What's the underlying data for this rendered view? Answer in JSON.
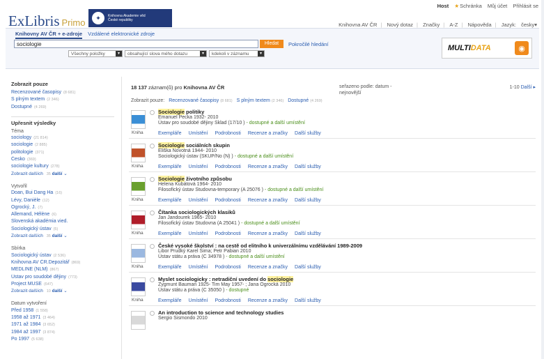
{
  "topbar": {
    "host": "Host",
    "clipboard": "Schránka",
    "account": "Můj účet",
    "login": "Přihlásit se"
  },
  "logo": {
    "exlibris": "ExLibris",
    "primo": "Primo"
  },
  "institution": {
    "name_line1": "Knihovna Akademie věd",
    "name_line2": "České republiky"
  },
  "mainnav": [
    "Knihovna AV ČR",
    "Nový dotaz",
    "Značky",
    "A-Z",
    "Nápověda",
    "Jazyk:",
    "česky"
  ],
  "tabs": {
    "active": "Knihovny AV ČR + e-zdroje",
    "second": "Vzdálené elektronické zdroje"
  },
  "search": {
    "value": "sociologie",
    "button": "Hledat",
    "advanced": "Pokročilé hledání"
  },
  "selects": [
    "Všechny položky",
    "obsahující slova mého dotazu",
    "kdekoli v záznamu"
  ],
  "multidata": {
    "logo_a": "MULTI",
    "logo_b": "DATA"
  },
  "sidebar": {
    "show_only_title": "Zobrazit pouze",
    "show_only": [
      {
        "label": "Recenzované časopisy",
        "count": "(8 681)"
      },
      {
        "label": "S plným textem",
        "count": "(2 346)"
      },
      {
        "label": "Dostupné",
        "count": "(4 269)"
      }
    ],
    "refine_title": "Upřesnit výsledky",
    "topic_title": "Téma",
    "topics": [
      {
        "label": "sociology",
        "count": "(21 814)"
      },
      {
        "label": "sociologie",
        "count": "(2 885)"
      },
      {
        "label": "politologie",
        "count": "(371)"
      },
      {
        "label": "Česko",
        "count": "(369)"
      },
      {
        "label": "sociologie kultury",
        "count": "(278)"
      }
    ],
    "topics_more": "Zobrazit dalších",
    "topics_more_count": "35",
    "more_label": "další",
    "creator_title": "Vytvořil",
    "creators": [
      {
        "label": "Doan, Bui Dang Ha",
        "count": "(16)"
      },
      {
        "label": "Lévy, Danièle",
        "count": "(12)"
      },
      {
        "label": "Ogrocký, J.",
        "count": "(7)"
      },
      {
        "label": "Allemand, Hélène",
        "count": "(6)"
      },
      {
        "label": "Slovenská akadémia vied.",
        "count": ""
      },
      {
        "label": "Sociologický ústav",
        "count": "(5)"
      }
    ],
    "creators_more": "Zobrazit dalších",
    "creators_more_count": "35",
    "collection_title": "Sbírka",
    "collections": [
      {
        "label": "Sociologický ústav",
        "count": "(2 536)"
      },
      {
        "label": "Knihovna AV ČR.Depozitář",
        "count": "(869)"
      },
      {
        "label": "MEDLINE (NLM)",
        "count": "(867)"
      },
      {
        "label": "Ústav pro soudobé dějiny",
        "count": "(773)"
      },
      {
        "label": "Project MUSE",
        "count": "(647)"
      }
    ],
    "collections_more": "Zobrazit dalších",
    "collections_more_count": "10",
    "date_title": "Datum vytvoření",
    "dates": [
      {
        "label": "Před 1958",
        "count": "(1 558)"
      },
      {
        "label": "1958 až 1971",
        "count": "(3 464)"
      },
      {
        "label": "1971 až 1984",
        "count": "(3 652)"
      },
      {
        "label": "1984 až 1997",
        "count": "(3 874)"
      },
      {
        "label": "Po 1997",
        "count": "(5 638)"
      }
    ]
  },
  "results_header": {
    "count": "18 137",
    "label": "záznam(ů) pro",
    "scope": "Knihovna AV ČR"
  },
  "sort": {
    "label": "seřazeno podle:",
    "value": "datum - nejnovější"
  },
  "pager": {
    "range": "1-10",
    "next": "Další"
  },
  "refine_bar": {
    "label": "Zobrazit pouze:",
    "items": [
      {
        "label": "Recenzované časopisy",
        "count": "(8 681)"
      },
      {
        "label": "S plným textem",
        "count": "(2 346)"
      },
      {
        "label": "Dostupné",
        "count": "(4 269)"
      }
    ]
  },
  "actions": [
    "Exempláře",
    "Umístění",
    "Podrobnosti",
    "Recenze a značky",
    "Další služby"
  ],
  "records": [
    {
      "title_hl": "Sociologie",
      "title_rest": " politiky",
      "author": "Emanuel Pecka 1932- 2010",
      "location": "Ústav pro soudobé dějiny Sklad (17/10 )",
      "availability": " - dostupné a další umístění",
      "format": "Kniha",
      "color": "#3b8fd6"
    },
    {
      "title_hl": "Sociologie",
      "title_rest": " sociálních skupin",
      "author": "Eliška Novotná 1944- 2010",
      "location": "Sociologický ústav   (SKUP/No (N) )",
      "availability": " - dostupné a další umístění",
      "format": "Kniha",
      "color": "#c0522a"
    },
    {
      "title_hl": "Sociologie",
      "title_rest": " životního způsobu",
      "author": "Helena Kubátová 1964- 2010",
      "location": "Filosofický ústav Studovna-temporary (A 25076 )",
      "availability": " - dostupné a další umístění",
      "format": "Kniha",
      "color": "#6aa02e"
    },
    {
      "title_hl": "",
      "title_rest": "Čítanka sociologických klasiků",
      "author": "Jan Jandourek 1965- 2010",
      "location": "Filosofický ústav Studovna (A 25041 )",
      "availability": " - dostupné a další umístění",
      "format": "Kniha",
      "color": "#b01e2a"
    },
    {
      "title_hl": "",
      "title_rest": "České vysoké školství : na cestě od elitního k univerzálnímu vzdělávání 1989-2009",
      "author": "Libor Prudký Karel Šima; Petr Pabian 2010",
      "location": "Ústav státu a práva  (C 34978 )",
      "availability": " - dostupné a další umístění",
      "format": "Kniha",
      "color": "#9bb8e0"
    },
    {
      "title_hl": "sociologie",
      "title_prefix": "Myslet sociologicky : netradiční uvedení do ",
      "title_rest": "",
      "author": "Zygmunt Bauman 1925- Tim May 1957- ; Jana Ogrocká 2010",
      "location": "Ústav státu a práva  (C 35050 )",
      "availability": " - dostupné",
      "format": "Kniha",
      "color": "#3b4aa0"
    },
    {
      "title_hl": "",
      "title_rest": "An introduction to science and technology studies",
      "author": "Sergio Sismondo 2010",
      "location": "",
      "availability": "",
      "format": "",
      "color": "#d9d9d9"
    }
  ]
}
